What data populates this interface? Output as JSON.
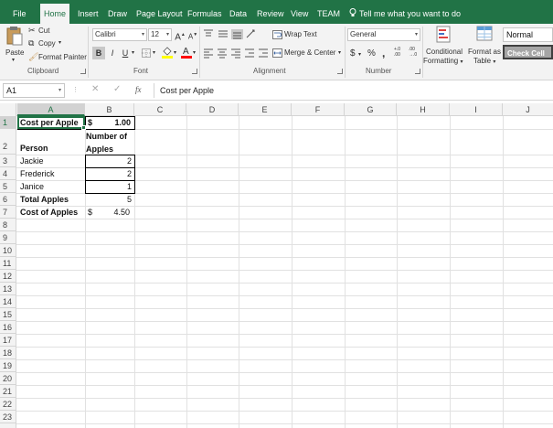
{
  "tabs": [
    {
      "label": "File",
      "active": false
    },
    {
      "label": "Home",
      "active": true
    },
    {
      "label": "Insert",
      "active": false
    },
    {
      "label": "Draw",
      "active": false
    },
    {
      "label": "Page Layout",
      "active": false
    },
    {
      "label": "Formulas",
      "active": false
    },
    {
      "label": "Data",
      "active": false
    },
    {
      "label": "Review",
      "active": false
    },
    {
      "label": "View",
      "active": false
    },
    {
      "label": "TEAM",
      "active": false
    }
  ],
  "tell_me": "Tell me what you want to do",
  "clipboard": {
    "paste": "Paste",
    "cut": "Cut",
    "copy": "Copy",
    "format_painter": "Format Painter",
    "label": "Clipboard"
  },
  "font": {
    "family": "Calibri",
    "size": "12",
    "grow": "A",
    "shrink": "A",
    "bold": "B",
    "italic": "I",
    "underline": "U",
    "label": "Font"
  },
  "alignment": {
    "wrap_text": "Wrap Text",
    "merge_center": "Merge & Center",
    "label": "Alignment"
  },
  "number": {
    "format": "General",
    "currency": "$",
    "percent": "%",
    "comma": ",",
    "inc_decimal": "+.0 .00",
    "dec_decimal": ".00 →.0",
    "label": "Number"
  },
  "styles": {
    "conditional_formatting_1": "Conditional",
    "conditional_formatting_2": "Formatting",
    "format_as_table_1": "Format as",
    "format_as_table_2": "Table",
    "normal": "Normal",
    "check_cell": "Check Cell"
  },
  "formula_bar": {
    "name_box": "A1",
    "fx": "fx",
    "content": "Cost per Apple"
  },
  "columns": [
    "A",
    "B",
    "C",
    "D",
    "E",
    "F",
    "G",
    "H",
    "I",
    "J"
  ],
  "rows": [
    "1",
    "2",
    "3",
    "4",
    "5",
    "6",
    "7",
    "8",
    "9",
    "10",
    "11",
    "12",
    "13",
    "14",
    "15",
    "16",
    "17",
    "18",
    "19",
    "20",
    "21",
    "22",
    "23"
  ],
  "cells": {
    "A1": "Cost per Apple",
    "B1_currency": "$",
    "B1_value": "1.00",
    "B2_line1": "Number of",
    "B2_line2": "Apples",
    "A2": "Person",
    "A3": "Jackie",
    "B3": "2",
    "A4": "Frederick",
    "B4": "2",
    "A5": "Janice",
    "B5": "1",
    "A6": "Total Apples",
    "B6": "5",
    "A7": "Cost of Apples",
    "B7_currency": "$",
    "B7_value": "4.50"
  },
  "colors": {
    "accent": "#217346",
    "grid": "#e1e1e1",
    "check_cell_bg": "#a5a5a5"
  }
}
